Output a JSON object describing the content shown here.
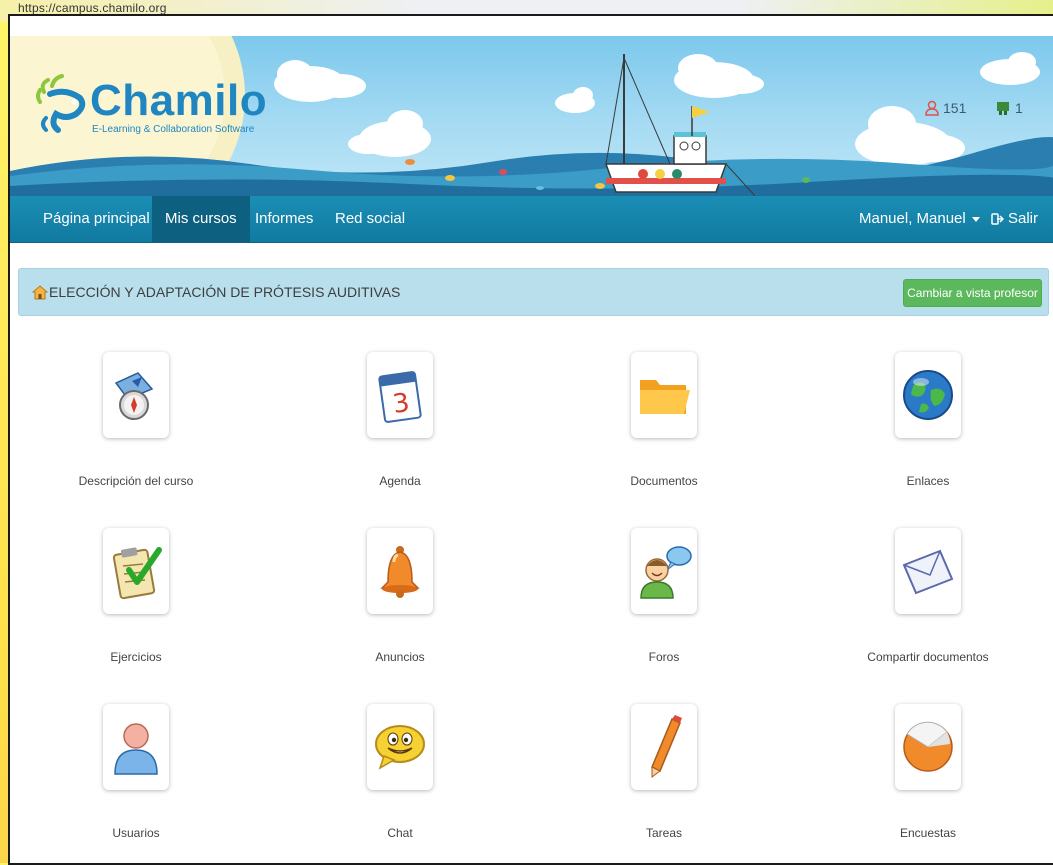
{
  "browser": {
    "url": "https://campus.chamilo.org"
  },
  "header": {
    "logo_title": "Chamilo",
    "logo_subtitle": "E-Learning & Collaboration Software",
    "online_count": "151",
    "messages_count": "1"
  },
  "nav": {
    "items": [
      {
        "label": "Página principal"
      },
      {
        "label": "Mis cursos"
      },
      {
        "label": "Informes"
      },
      {
        "label": "Red social"
      }
    ],
    "user_label": "Manuel, Manuel",
    "logout_label": "Salir"
  },
  "course": {
    "title": "ELECCIÓN Y ADAPTACIÓN DE PRÓTESIS AUDITIVAS",
    "switch_button": "Cambiar a vista profesor"
  },
  "tools": [
    {
      "label": "Descripción del curso",
      "icon": "compass-icon"
    },
    {
      "label": "Agenda",
      "icon": "calendar-icon"
    },
    {
      "label": "Documentos",
      "icon": "folder-icon"
    },
    {
      "label": "Enlaces",
      "icon": "globe-icon"
    },
    {
      "label": "Ejercicios",
      "icon": "checklist-icon"
    },
    {
      "label": "Anuncios",
      "icon": "bell-icon"
    },
    {
      "label": "Foros",
      "icon": "forum-icon"
    },
    {
      "label": "Compartir documentos",
      "icon": "envelope-icon"
    },
    {
      "label": "Usuarios",
      "icon": "user-icon"
    },
    {
      "label": "Chat",
      "icon": "chat-smiley-icon"
    },
    {
      "label": "Tareas",
      "icon": "pencil-icon"
    },
    {
      "label": "Encuestas",
      "icon": "pie-chart-icon"
    }
  ],
  "colors": {
    "brand": "#1f86c2",
    "navbar": "#1585ab",
    "course_bar": "#b9dfec",
    "teacher_button": "#5cb85c"
  }
}
